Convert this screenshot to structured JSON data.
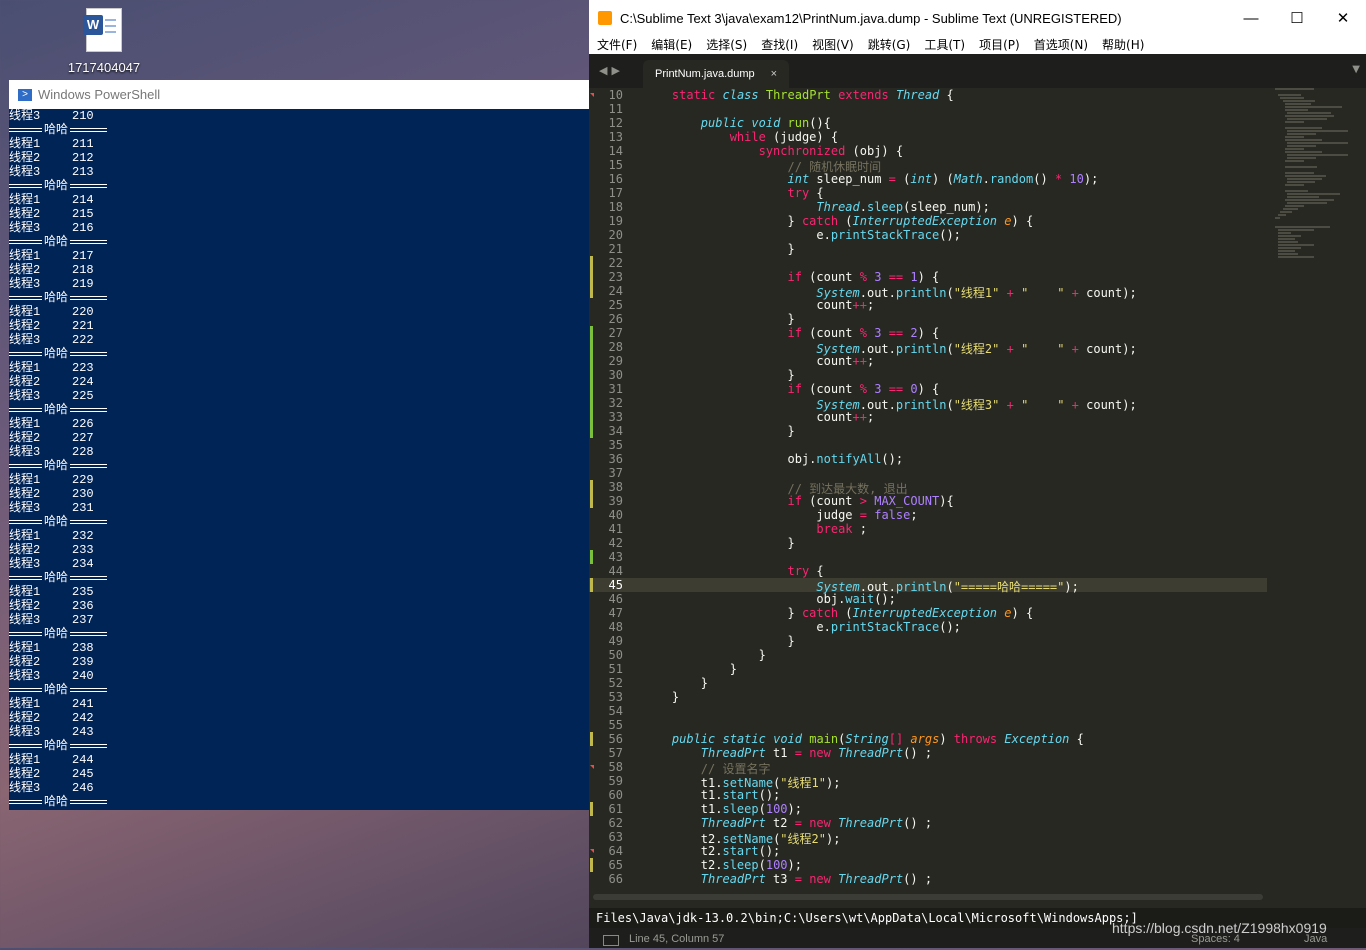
{
  "desktop": {
    "icon_label": "1717404047",
    "icon_name": "word-document-icon"
  },
  "powershell": {
    "title": "Windows PowerShell",
    "separator_text": "哈哈",
    "lines": [
      {
        "label": "线程3",
        "num": "210"
      },
      {
        "sep": true
      },
      {
        "label": "线程1",
        "num": "211"
      },
      {
        "label": "线程2",
        "num": "212"
      },
      {
        "label": "线程3",
        "num": "213"
      },
      {
        "sep": true
      },
      {
        "label": "线程1",
        "num": "214"
      },
      {
        "label": "线程2",
        "num": "215"
      },
      {
        "label": "线程3",
        "num": "216"
      },
      {
        "sep": true
      },
      {
        "label": "线程1",
        "num": "217"
      },
      {
        "label": "线程2",
        "num": "218"
      },
      {
        "label": "线程3",
        "num": "219"
      },
      {
        "sep": true
      },
      {
        "label": "线程1",
        "num": "220"
      },
      {
        "label": "线程2",
        "num": "221"
      },
      {
        "label": "线程3",
        "num": "222"
      },
      {
        "sep": true
      },
      {
        "label": "线程1",
        "num": "223"
      },
      {
        "label": "线程2",
        "num": "224"
      },
      {
        "label": "线程3",
        "num": "225"
      },
      {
        "sep": true
      },
      {
        "label": "线程1",
        "num": "226"
      },
      {
        "label": "线程2",
        "num": "227"
      },
      {
        "label": "线程3",
        "num": "228"
      },
      {
        "sep": true
      },
      {
        "label": "线程1",
        "num": "229"
      },
      {
        "label": "线程2",
        "num": "230"
      },
      {
        "label": "线程3",
        "num": "231"
      },
      {
        "sep": true
      },
      {
        "label": "线程1",
        "num": "232"
      },
      {
        "label": "线程2",
        "num": "233"
      },
      {
        "label": "线程3",
        "num": "234"
      },
      {
        "sep": true
      },
      {
        "label": "线程1",
        "num": "235"
      },
      {
        "label": "线程2",
        "num": "236"
      },
      {
        "label": "线程3",
        "num": "237"
      },
      {
        "sep": true
      },
      {
        "label": "线程1",
        "num": "238"
      },
      {
        "label": "线程2",
        "num": "239"
      },
      {
        "label": "线程3",
        "num": "240"
      },
      {
        "sep": true
      },
      {
        "label": "线程1",
        "num": "241"
      },
      {
        "label": "线程2",
        "num": "242"
      },
      {
        "label": "线程3",
        "num": "243"
      },
      {
        "sep": true
      },
      {
        "label": "线程1",
        "num": "244"
      },
      {
        "label": "线程2",
        "num": "245"
      },
      {
        "label": "线程3",
        "num": "246"
      },
      {
        "sep": true
      }
    ]
  },
  "sublime": {
    "title": "C:\\Sublime Text 3\\java\\exam12\\PrintNum.java.dump - Sublime Text (UNREGISTERED)",
    "window_buttons": [
      "—",
      "☐",
      "✕"
    ],
    "menu": [
      "文件(F)",
      "编辑(E)",
      "选择(S)",
      "查找(I)",
      "视图(V)",
      "跳转(G)",
      "工具(T)",
      "项目(P)",
      "首选项(N)",
      "帮助(H)"
    ],
    "tab": {
      "label": "PrintNum.java.dump",
      "close": "×"
    },
    "current_line": 45,
    "code": [
      {
        "n": "10",
        "m": "r",
        "h": "    <span class='k'>static</span> <span class='t'>class</span> <span class='g2'>ThreadPrt</span> <span class='k'>extends</span> <span class='t'>Thread</span> {"
      },
      {
        "n": "11",
        "h": ""
      },
      {
        "n": "12",
        "h": "        <span class='t'>public</span> <span class='t'>void</span> <span class='g2'>run</span>(){"
      },
      {
        "n": "13",
        "h": "            <span class='k'>while</span> (judge) {"
      },
      {
        "n": "14",
        "h": "                <span class='k'>synchronized</span> (obj) {"
      },
      {
        "n": "15",
        "h": "                    <span class='c'>// 随机休眠时间</span>"
      },
      {
        "n": "16",
        "h": "                    <span class='t'>int</span> sleep_num <span class='k'>=</span> (<span class='t'>int</span>) (<span class='t'>Math</span>.<span class='f'>random</span>() <span class='k'>*</span> <span class='n'>10</span>);"
      },
      {
        "n": "17",
        "h": "                    <span class='k'>try</span> {"
      },
      {
        "n": "18",
        "h": "                        <span class='t'>Thread</span>.<span class='f'>sleep</span>(sleep_num);"
      },
      {
        "n": "19",
        "h": "                    } <span class='k'>catch</span> (<span class='t'>InterruptedException</span> <span class='o'>e</span>) {"
      },
      {
        "n": "20",
        "h": "                        e.<span class='f'>printStackTrace</span>();"
      },
      {
        "n": "21",
        "h": "                    }"
      },
      {
        "n": "22",
        "m": "y",
        "h": ""
      },
      {
        "n": "23",
        "m": "y",
        "h": "                    <span class='k'>if</span> (count <span class='k'>%</span> <span class='n'>3</span> <span class='k'>==</span> <span class='n'>1</span>) {"
      },
      {
        "n": "24",
        "m": "y",
        "h": "                        <span class='t'>System</span>.out.<span class='f'>println</span>(<span class='s'>\"线程1\"</span> <span class='k'>+</span> <span class='s'>\"    \"</span> <span class='k'>+</span> count);"
      },
      {
        "n": "25",
        "h": "                        count<span class='k'>++</span>;"
      },
      {
        "n": "26",
        "h": "                    }"
      },
      {
        "n": "27",
        "m": "g",
        "h": "                    <span class='k'>if</span> (count <span class='k'>%</span> <span class='n'>3</span> <span class='k'>==</span> <span class='n'>2</span>) {"
      },
      {
        "n": "28",
        "m": "g",
        "h": "                        <span class='t'>System</span>.out.<span class='f'>println</span>(<span class='s'>\"线程2\"</span> <span class='k'>+</span> <span class='s'>\"    \"</span> <span class='k'>+</span> count);"
      },
      {
        "n": "29",
        "m": "g",
        "h": "                        count<span class='k'>++</span>;"
      },
      {
        "n": "30",
        "m": "g",
        "h": "                    }"
      },
      {
        "n": "31",
        "m": "g",
        "h": "                    <span class='k'>if</span> (count <span class='k'>%</span> <span class='n'>3</span> <span class='k'>==</span> <span class='n'>0</span>) {"
      },
      {
        "n": "32",
        "m": "g",
        "h": "                        <span class='t'>System</span>.out.<span class='f'>println</span>(<span class='s'>\"线程3\"</span> <span class='k'>+</span> <span class='s'>\"    \"</span> <span class='k'>+</span> count);"
      },
      {
        "n": "33",
        "m": "g",
        "h": "                        count<span class='k'>++</span>;"
      },
      {
        "n": "34",
        "m": "g",
        "h": "                    }"
      },
      {
        "n": "35",
        "h": ""
      },
      {
        "n": "36",
        "h": "                    obj.<span class='f'>notifyAll</span>();"
      },
      {
        "n": "37",
        "h": ""
      },
      {
        "n": "38",
        "m": "y",
        "h": "                    <span class='c'>// 到达最大数, 退出</span>"
      },
      {
        "n": "39",
        "m": "y",
        "h": "                    <span class='k'>if</span> (count <span class='k'>&gt;</span> <span class='n'>MAX_COUNT</span>){"
      },
      {
        "n": "40",
        "h": "                        judge <span class='k'>=</span> <span class='n'>false</span>;"
      },
      {
        "n": "41",
        "h": "                        <span class='k'>break</span> ;"
      },
      {
        "n": "42",
        "h": "                    }"
      },
      {
        "n": "43",
        "m": "g",
        "h": ""
      },
      {
        "n": "44",
        "h": "                    <span class='k'>try</span> {"
      },
      {
        "n": "45",
        "m": "y",
        "h": "                        <span class='t'>System</span>.out.<span class='f'>println</span>(<span class='s'>\"=====哈哈=====\"</span>);"
      },
      {
        "n": "46",
        "h": "                        obj.<span class='f'>wait</span>();"
      },
      {
        "n": "47",
        "h": "                    } <span class='k'>catch</span> (<span class='t'>InterruptedException</span> <span class='o'>e</span>) {"
      },
      {
        "n": "48",
        "h": "                        e.<span class='f'>printStackTrace</span>();"
      },
      {
        "n": "49",
        "h": "                    }"
      },
      {
        "n": "50",
        "h": "                }"
      },
      {
        "n": "51",
        "h": "            }"
      },
      {
        "n": "52",
        "h": "        }"
      },
      {
        "n": "53",
        "h": "    }"
      },
      {
        "n": "54",
        "h": ""
      },
      {
        "n": "55",
        "h": ""
      },
      {
        "n": "56",
        "m": "y",
        "h": "    <span class='t'>public</span> <span class='t'>static</span> <span class='t'>void</span> <span class='g2'>main</span>(<span class='t'>String</span><span class='k'>[]</span> <span class='o'>args</span>) <span class='k'>throws</span> <span class='t'>Exception</span> {"
      },
      {
        "n": "57",
        "h": "        <span class='t'>ThreadPrt</span> t1 <span class='k'>=</span> <span class='k'>new</span> <span class='t'>ThreadPrt</span>() ;"
      },
      {
        "n": "58",
        "m": "r",
        "h": "        <span class='c'>// 设置名字</span>"
      },
      {
        "n": "59",
        "h": "        t1.<span class='f'>setName</span>(<span class='s'>\"线程1\"</span>);"
      },
      {
        "n": "60",
        "h": "        t1.<span class='f'>start</span>();"
      },
      {
        "n": "61",
        "m": "y",
        "h": "        t1.<span class='f'>sleep</span>(<span class='n'>100</span>);"
      },
      {
        "n": "62",
        "h": "        <span class='t'>ThreadPrt</span> t2 <span class='k'>=</span> <span class='k'>new</span> <span class='t'>ThreadPrt</span>() ;"
      },
      {
        "n": "63",
        "h": "        t2.<span class='f'>setName</span>(<span class='s'>\"线程2\"</span>);"
      },
      {
        "n": "64",
        "m": "r",
        "h": "        t2.<span class='f'>start</span>();"
      },
      {
        "n": "65",
        "m": "y",
        "h": "        t2.<span class='f'>sleep</span>(<span class='n'>100</span>);"
      },
      {
        "n": "66",
        "h": "        <span class='t'>ThreadPrt</span> t3 <span class='k'>=</span> <span class='k'>new</span> <span class='t'>ThreadPrt</span>() ;"
      }
    ],
    "console_text": "Files\\Java\\jdk-13.0.2\\bin;C:\\Users\\wt\\AppData\\Local\\Microsoft\\WindowsApps;]",
    "status": {
      "position": "Line 45, Column 57",
      "spaces": "Spaces: 4",
      "syntax": "Java"
    }
  },
  "watermark": "https://blog.csdn.net/Z1998hx0919"
}
